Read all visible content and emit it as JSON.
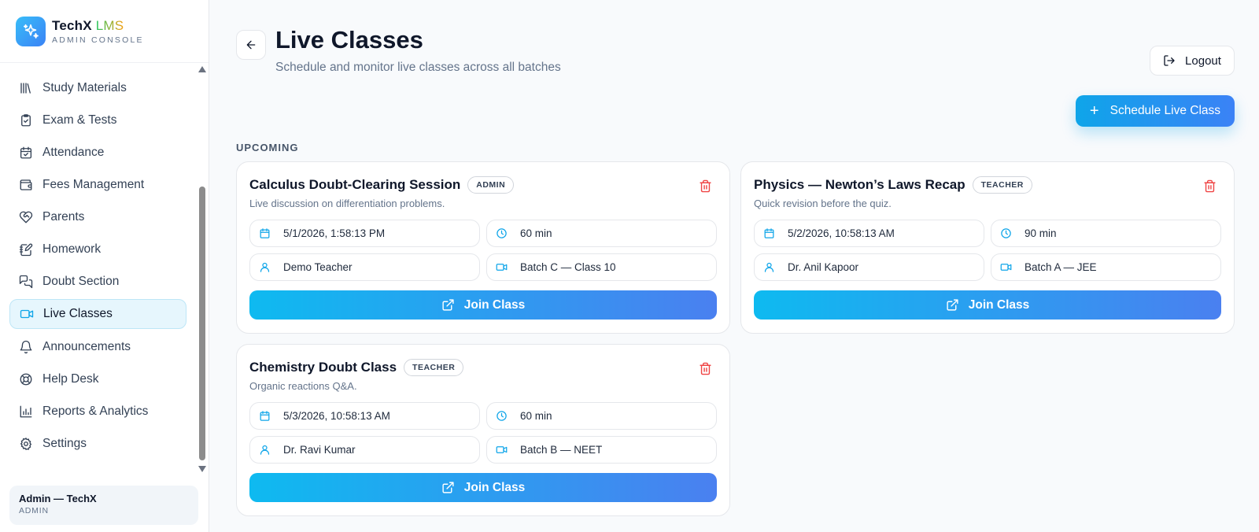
{
  "brand": {
    "name": "TechX",
    "name_accent": "LMS",
    "subtitle": "ADMIN CONSOLE"
  },
  "sidebar": {
    "items": [
      {
        "label": "Study Materials",
        "icon": "library-icon",
        "active": false
      },
      {
        "label": "Exam & Tests",
        "icon": "clipboard-check-icon",
        "active": false
      },
      {
        "label": "Attendance",
        "icon": "calendar-check-icon",
        "active": false
      },
      {
        "label": "Fees Management",
        "icon": "wallet-icon",
        "active": false
      },
      {
        "label": "Parents",
        "icon": "heart-handshake-icon",
        "active": false
      },
      {
        "label": "Homework",
        "icon": "notebook-pen-icon",
        "active": false
      },
      {
        "label": "Doubt Section",
        "icon": "messages-icon",
        "active": false
      },
      {
        "label": "Live Classes",
        "icon": "video-icon",
        "active": true
      },
      {
        "label": "Announcements",
        "icon": "bell-icon",
        "active": false
      },
      {
        "label": "Help Desk",
        "icon": "lifebuoy-icon",
        "active": false
      },
      {
        "label": "Reports & Analytics",
        "icon": "bar-chart-icon",
        "active": false
      },
      {
        "label": "Settings",
        "icon": "gear-icon",
        "active": false
      }
    ],
    "user": {
      "name": "Admin — TechX",
      "role": "ADMIN"
    }
  },
  "header": {
    "title": "Live Classes",
    "subtitle": "Schedule and monitor live classes across all batches",
    "logout_label": "Logout",
    "schedule_label": "Schedule Live Class"
  },
  "section_label": "UPCOMING",
  "classes": [
    {
      "title": "Calculus Doubt-Clearing Session",
      "role": "ADMIN",
      "description": "Live discussion on differentiation problems.",
      "datetime": "5/1/2026, 1:58:13 PM",
      "duration": "60 min",
      "teacher": "Demo Teacher",
      "batch": "Batch C — Class 10",
      "join_label": "Join Class"
    },
    {
      "title": "Physics — Newton’s Laws Recap",
      "role": "TEACHER",
      "description": "Quick revision before the quiz.",
      "datetime": "5/2/2026, 10:58:13 AM",
      "duration": "90 min",
      "teacher": "Dr. Anil Kapoor",
      "batch": "Batch A — JEE",
      "join_label": "Join Class"
    },
    {
      "title": "Chemistry Doubt Class",
      "role": "TEACHER",
      "description": "Organic reactions Q&A.",
      "datetime": "5/3/2026, 10:58:13 AM",
      "duration": "60 min",
      "teacher": "Dr. Ravi Kumar",
      "batch": "Batch B — NEET",
      "join_label": "Join Class"
    }
  ],
  "colors": {
    "accent": "#0ea5e9",
    "accent_end": "#3b82f6",
    "danger": "#ef4444",
    "active_bg": "#e6f6fd"
  }
}
